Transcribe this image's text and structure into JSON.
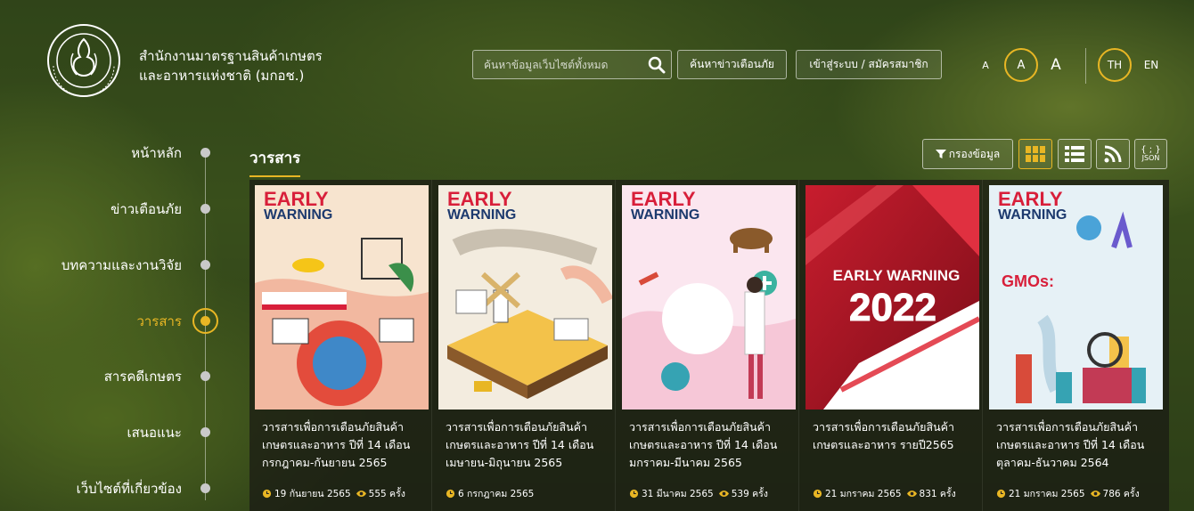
{
  "header": {
    "org_line1": "สำนักงานมาตรฐานสินค้าเกษตร",
    "org_line2": "และอาหารแห่งชาติ (มกอช.)",
    "search_placeholder": "ค้นหาข้อมูลเว็บไซต์ทั้งหมด",
    "alert_search_label": "ค้นหาข่าวเตือนภัย",
    "login_label": "เข้าสู่ระบบ / สมัครสมาชิก",
    "font_sizes": [
      "A",
      "A",
      "A"
    ],
    "languages": [
      "TH",
      "EN"
    ],
    "accent_color": "#e8b624"
  },
  "sidebar": {
    "items": [
      {
        "label": "หน้าหลัก"
      },
      {
        "label": "ข่าวเตือนภัย"
      },
      {
        "label": "บทความและงานวิจัย"
      },
      {
        "label": "วารสาร"
      },
      {
        "label": "สารคดีเกษตร"
      },
      {
        "label": "เสนอแนะ"
      },
      {
        "label": "เว็บไซต์ที่เกี่ยวข้อง"
      }
    ],
    "active_index": 3
  },
  "content": {
    "section_title": "วารสาร",
    "filter_label": "กรองข้อมูล",
    "json_label": "JSON",
    "json_braces": "{ ; }",
    "cards": [
      {
        "title": "วารสารเพื่อการเตือนภัยสินค้าเกษตรและอาหาร ปีที่ 14 เดือน กรกฎาคม-กันยายน 2565",
        "date": "19 กันยายน 2565",
        "views": "555 ครั้ง",
        "cover_title1": "EARLY",
        "cover_title2": "WARNING",
        "cover_year": ""
      },
      {
        "title": "วารสารเพื่อการเตือนภัยสินค้าเกษตรและอาหาร ปีที่ 14 เดือน เมษายน-มิถุนายน 2565",
        "date": "6 กรกฎาคม 2565",
        "views": "",
        "cover_title1": "EARLY",
        "cover_title2": "WARNING",
        "cover_year": ""
      },
      {
        "title": "วารสารเพื่อการเตือนภัยสินค้าเกษตรและอาหาร ปีที่ 14 เดือน มกราคม-มีนาคม 2565",
        "date": "31 มีนาคม 2565",
        "views": "539 ครั้ง",
        "cover_title1": "EARLY",
        "cover_title2": "WARNING",
        "cover_year": ""
      },
      {
        "title": "วารสารเพื่อการเตือนภัยสินค้าเกษตรและอาหาร รายปี2565",
        "date": "21 มกราคม 2565",
        "views": "831 ครั้ง",
        "cover_title1": "EARLY WARNING",
        "cover_title2": "",
        "cover_year": "2022"
      },
      {
        "title": "วารสารเพื่อการเตือนภัยสินค้าเกษตรและอาหาร ปีที่ 14 เดือน ตุลาคม-ธันวาคม 2564",
        "date": "21 มกราคม 2565",
        "views": "786 ครั้ง",
        "cover_title1": "EARLY",
        "cover_title2": "WARNING",
        "cover_year": "",
        "cover_headline": "GMOs:"
      }
    ]
  }
}
